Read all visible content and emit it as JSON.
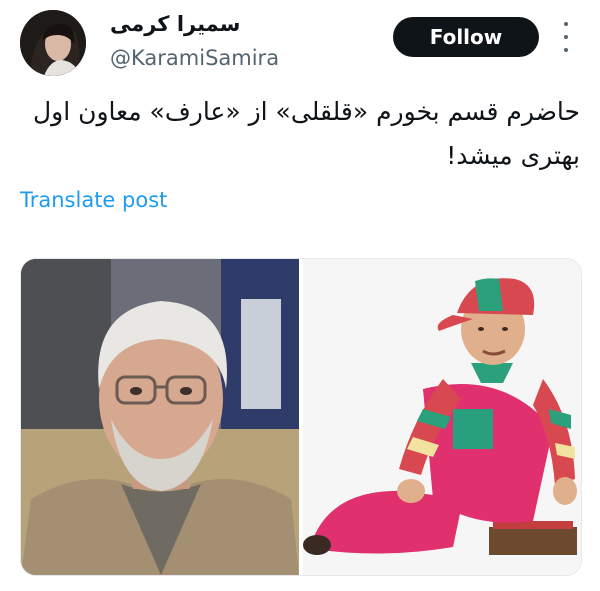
{
  "author": {
    "display_name": "سمیرا کرمی",
    "handle": "@KaramiSamira",
    "avatar_icon": "profile-photo"
  },
  "actions": {
    "follow_label": "Follow",
    "more_icon": "more-vertical-icon"
  },
  "post": {
    "text_line1": "حاضرم قسم بخورم «قلقلی» از «عارف» معاون اول",
    "text_line2": "بهتری میشد!",
    "translate_label": "Translate post"
  },
  "media": {
    "images": [
      {
        "name": "photo-gray-haired-man"
      },
      {
        "name": "photo-clown-costume"
      }
    ]
  },
  "colors": {
    "text": "#0f1419",
    "secondary": "#536471",
    "link": "#1d9bf0",
    "button_bg": "#0f1419"
  }
}
